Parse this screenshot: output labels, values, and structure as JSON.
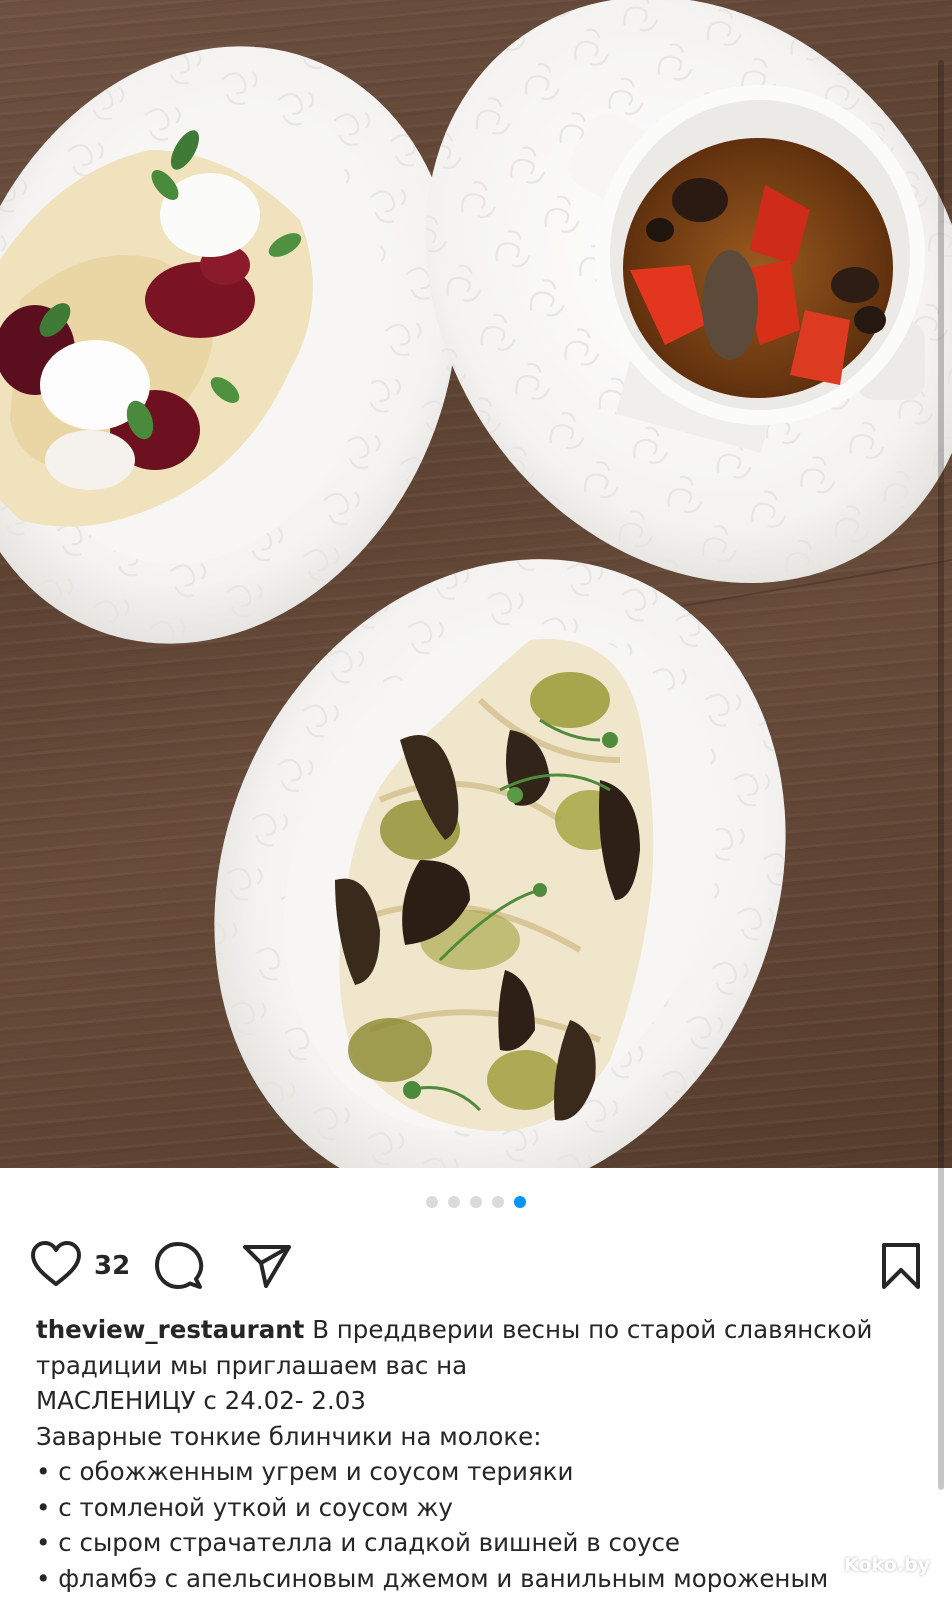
{
  "post": {
    "image_description_hint": "",
    "carousel": {
      "count": 5,
      "active_index": 5
    },
    "likes": "32",
    "username": "theview_restaurant",
    "caption_first": "В преддверии весны по старой славянской традиции мы приглашаем вас на",
    "caption_lines": [
      "МАСЛЕНИЦУ с 24.02- 2.03",
      "Заварные тонкие блинчики на молоке:",
      "• с обожженным угрем и соусом терияки",
      "• с томленой уткой и соусом жу",
      "• с сыром страчателла и сладкой вишней в соусе",
      "• фламбэ с апельсиновым джемом и ванильным мороженым"
    ]
  },
  "icons": {
    "like": "heart-icon",
    "comment": "comment-icon",
    "share": "paper-plane-icon",
    "save": "bookmark-icon"
  },
  "watermark": "Koko.by",
  "colors": {
    "text": "#262626",
    "active_dot": "#0095f6",
    "inactive_dot": "#dbdbdb"
  }
}
